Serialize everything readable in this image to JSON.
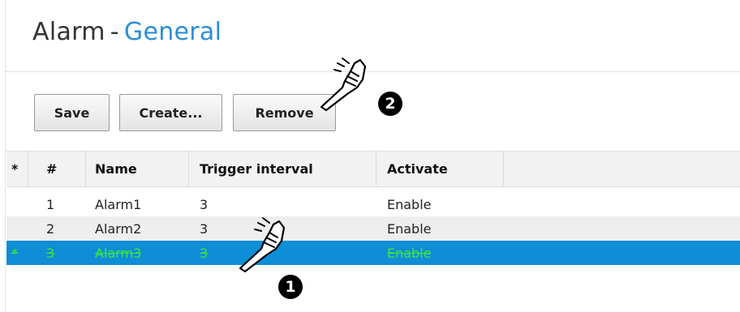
{
  "header": {
    "title_main": "Alarm",
    "title_sep": "-",
    "title_sub": "General"
  },
  "toolbar": {
    "save_label": "Save",
    "create_label": "Create...",
    "remove_label": "Remove"
  },
  "table": {
    "columns": [
      "*",
      "#",
      "Name",
      "Trigger interval",
      "Activate"
    ],
    "rows": [
      {
        "mark": "",
        "num": "1",
        "name": "Alarm1",
        "trigger": "3",
        "activate": "Enable",
        "selected": false
      },
      {
        "mark": "",
        "num": "2",
        "name": "Alarm2",
        "trigger": "3",
        "activate": "Enable",
        "selected": false
      },
      {
        "mark": "*",
        "num": "3",
        "name": "Alarm3",
        "trigger": "3",
        "activate": "Enable",
        "selected": true
      }
    ]
  },
  "callouts": {
    "step1": "1",
    "step2": "2"
  },
  "colors": {
    "title_accent": "#2b8fd6",
    "selected_row_bg": "#0d8ed6",
    "selected_row_text": "#3fe83a"
  },
  "icons": {
    "pointer": "pointing-hand-icon"
  }
}
